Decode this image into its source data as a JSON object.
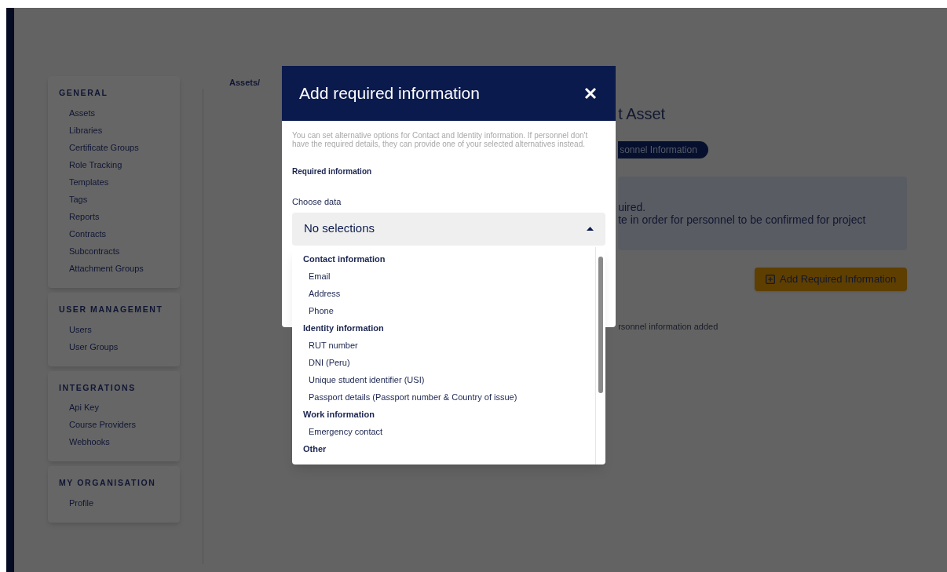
{
  "sidebar": {
    "sections": [
      {
        "title": "GENERAL",
        "items": [
          "Assets",
          "Libraries",
          "Certificate Groups",
          "Role Tracking",
          "Templates",
          "Tags",
          "Reports",
          "Contracts",
          "Subcontracts",
          "Attachment Groups"
        ]
      },
      {
        "title": "USER MANAGEMENT",
        "items": [
          "Users",
          "User Groups"
        ]
      },
      {
        "title": "INTEGRATIONS",
        "items": [
          "Api Key",
          "Course Providers",
          "Webhooks"
        ]
      },
      {
        "title": "MY ORGANISATION",
        "items": [
          "Profile"
        ]
      }
    ]
  },
  "breadcrumb": "Assets/",
  "background": {
    "title": "t Asset",
    "pill": "sonnel Information",
    "notice": [
      "uired.",
      "te in order for personnel to be confirmed for project"
    ],
    "button": "Add Required Information",
    "empty_note": "rsonnel information added"
  },
  "modal": {
    "title": "Add required information",
    "description": "You can set alternative options for Contact and Identity information. If personnel don't have the required details, they can provide one of your selected alternatives instead.",
    "section_label": "Required information",
    "field_label": "Choose data",
    "select_value": "No selections",
    "expanded": true,
    "options": [
      {
        "kind": "group",
        "label": "Contact information"
      },
      {
        "kind": "option",
        "label": "Email"
      },
      {
        "kind": "option",
        "label": "Address"
      },
      {
        "kind": "option",
        "label": "Phone"
      },
      {
        "kind": "group",
        "label": "Identity information"
      },
      {
        "kind": "option",
        "label": "RUT number"
      },
      {
        "kind": "option",
        "label": "DNI (Peru)"
      },
      {
        "kind": "option",
        "label": "Unique student identifier (USI)"
      },
      {
        "kind": "option",
        "label": "Passport details (Passport number & Country of issue)"
      },
      {
        "kind": "group",
        "label": "Work information"
      },
      {
        "kind": "option",
        "label": "Emergency contact"
      },
      {
        "kind": "group",
        "label": "Other"
      }
    ]
  }
}
